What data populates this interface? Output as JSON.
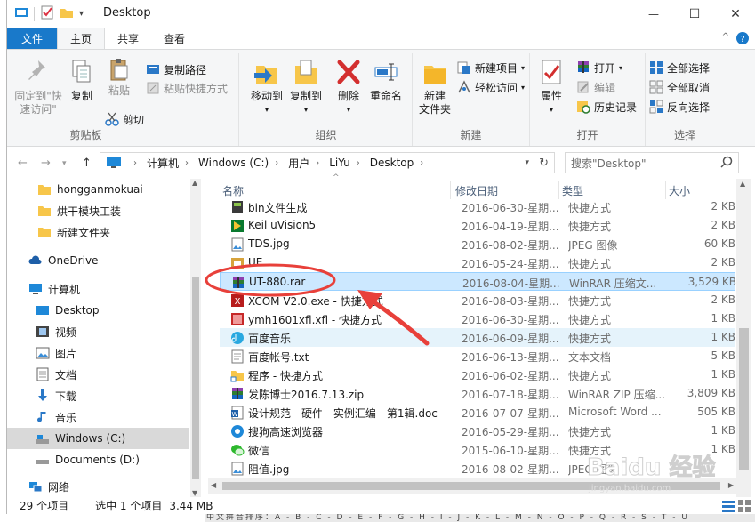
{
  "window": {
    "title": "Desktop",
    "buttons": {
      "minimize": "—",
      "maximize": "☐",
      "close": "✕"
    }
  },
  "ribbon_tabs": [
    {
      "label": "文件"
    },
    {
      "label": "主页"
    },
    {
      "label": "共享"
    },
    {
      "label": "查看"
    }
  ],
  "ribbon": {
    "clipboard": {
      "pin_label": "固定到\"快\n速访问\"",
      "copy_label": "复制",
      "paste_label": "粘贴",
      "copy_path_label": "复制路径",
      "paste_shortcut_label": "粘贴快捷方式",
      "cut_label": "剪切",
      "group_label": "剪贴板"
    },
    "organize": {
      "move_to_label": "移动到",
      "copy_to_label": "复制到",
      "delete_label": "删除",
      "rename_label": "重命名",
      "group_label": "组织"
    },
    "new": {
      "new_folder_label": "新建\n文件夹",
      "new_item_label": "新建项目",
      "easy_access_label": "轻松访问",
      "group_label": "新建"
    },
    "open": {
      "properties_label": "属性",
      "open_label": "打开",
      "edit_label": "编辑",
      "history_label": "历史记录",
      "group_label": "打开"
    },
    "select": {
      "select_all_label": "全部选择",
      "select_none_label": "全部取消",
      "invert_label": "反向选择",
      "group_label": "选择"
    }
  },
  "address": {
    "crumbs": [
      "计算机",
      "Windows (C:)",
      "用户",
      "LiYu",
      "Desktop"
    ],
    "search_placeholder": "搜索\"Desktop\""
  },
  "nav_pane": {
    "quick_access": [
      "hongganmokuai",
      "烘干模块工装",
      "新建文件夹"
    ],
    "onedrive": "OneDrive",
    "computer": "计算机",
    "computer_items": [
      "Desktop",
      "视频",
      "图片",
      "文档",
      "下载",
      "音乐",
      "Windows (C:)",
      "Documents (D:)"
    ],
    "network": "网络"
  },
  "file_list": {
    "columns": {
      "name": "名称",
      "date": "修改日期",
      "type": "类型",
      "size": "大小"
    },
    "rows": [
      {
        "name": "bin文件生成",
        "date": "2016-06-30-星期...",
        "type": "快捷方式",
        "size": "2 KB",
        "icon": "shortcut-icon"
      },
      {
        "name": "Keil uVision5",
        "date": "2016-04-19-星期...",
        "type": "快捷方式",
        "size": "2 KB",
        "icon": "keil-icon"
      },
      {
        "name": "TDS.jpg",
        "date": "2016-08-02-星期...",
        "type": "JPEG 图像",
        "size": "60 KB",
        "icon": "image-icon"
      },
      {
        "name": "UE",
        "date": "2016-05-24-星期...",
        "type": "快捷方式",
        "size": "2 KB",
        "icon": "ue-icon"
      },
      {
        "name": "UT-880.rar",
        "date": "2016-08-04-星期...",
        "type": "WinRAR 压缩文...",
        "size": "3,529 KB",
        "icon": "winrar-icon"
      },
      {
        "name": "XCOM V2.0.exe - 快捷方式",
        "date": "2016-08-03-星期...",
        "type": "快捷方式",
        "size": "2 KB",
        "icon": "xcom-icon"
      },
      {
        "name": "ymh1601xfl.xfl - 快捷方式",
        "date": "2016-06-30-星期...",
        "type": "快捷方式",
        "size": "1 KB",
        "icon": "xfl-icon"
      },
      {
        "name": "百度音乐",
        "date": "2016-06-09-星期...",
        "type": "快捷方式",
        "size": "1 KB",
        "icon": "baidu-music-icon"
      },
      {
        "name": "百度帐号.txt",
        "date": "2016-06-13-星期...",
        "type": "文本文档",
        "size": "5 KB",
        "icon": "text-file-icon"
      },
      {
        "name": "程序 - 快捷方式",
        "date": "2016-06-02-星期...",
        "type": "快捷方式",
        "size": "1 KB",
        "icon": "folder-shortcut-icon"
      },
      {
        "name": "发陈博士2016.7.13.zip",
        "date": "2016-07-18-星期...",
        "type": "WinRAR ZIP 压缩...",
        "size": "3,809 KB",
        "icon": "winrar-icon"
      },
      {
        "name": "设计规范 - 硬件 - 实例汇编 - 第1辑.doc",
        "date": "2016-07-07-星期...",
        "type": "Microsoft Word ...",
        "size": "505 KB",
        "icon": "word-icon"
      },
      {
        "name": "搜狗高速浏览器",
        "date": "2016-05-29-星期...",
        "type": "快捷方式",
        "size": "1 KB",
        "icon": "browser-icon"
      },
      {
        "name": "微信",
        "date": "2015-06-10-星期...",
        "type": "快捷方式",
        "size": "1 KB",
        "icon": "wechat-icon"
      },
      {
        "name": "阻值.jpg",
        "date": "2016-08-02-星期...",
        "type": "JPEG 图像",
        "size": "",
        "icon": "image-icon"
      }
    ],
    "hover_index": 7,
    "selected_index": 4
  },
  "status": {
    "count": "29 个项目",
    "selected": "选中 1 个项目",
    "size": "3.44 MB"
  },
  "background_text": "中文拼音排序：A - B - C - D - E - F - G - H - I - J - K - L - M - N - O - P - Q - R - S - T - U",
  "watermark": {
    "text": "Baidu 经验",
    "sub": "jingyan.baidu.com"
  },
  "colors": {
    "accent": "#1979ca",
    "selected_row": "#cce8ff",
    "hover_row": "#e5f3fb",
    "annotation": "#e8403a"
  }
}
